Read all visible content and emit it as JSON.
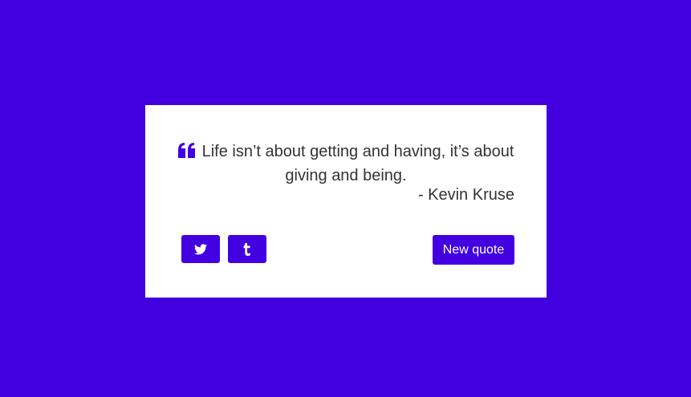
{
  "quote": {
    "text": "Life isn’t about getting and having, it’s about giving and being.",
    "author": "- Kevin Kruse"
  },
  "actions": {
    "twitter_icon": "twitter-icon",
    "tumblr_icon": "tumblr-icon",
    "new_quote_label": "New quote"
  },
  "colors": {
    "background": "#4200e0",
    "accent": "#4200e0",
    "card": "#ffffff",
    "text": "#333333"
  }
}
